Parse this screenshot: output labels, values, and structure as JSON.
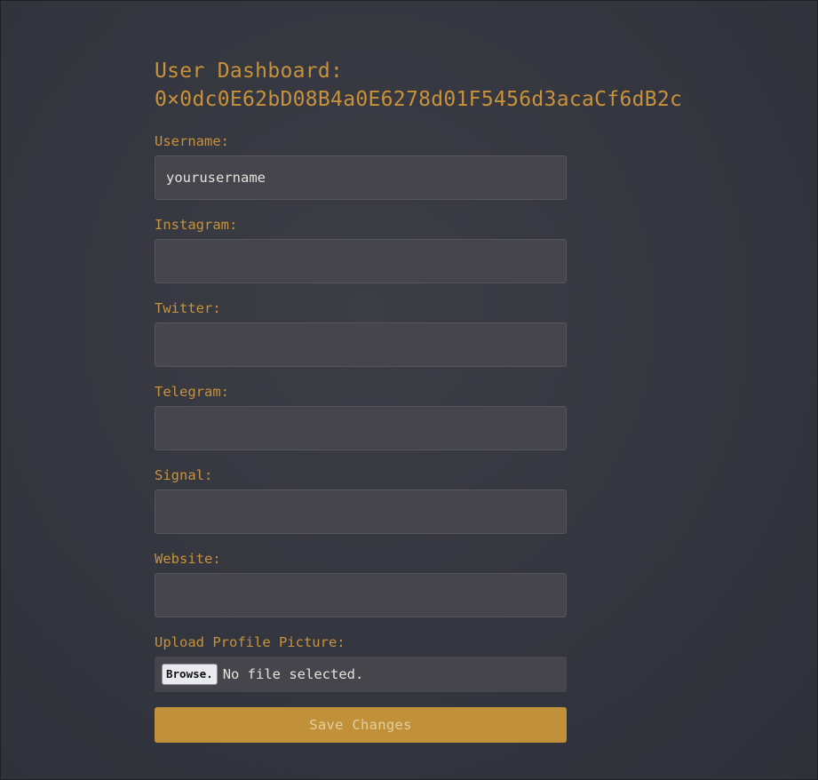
{
  "header": {
    "title_line1": "User Dashboard:",
    "title_line2": "0×0dc0E62bD08B4a0E6278d01F5456d3acaCf6dB2c"
  },
  "form": {
    "fields": [
      {
        "label": "Username:",
        "value": "yourusername",
        "placeholder": ""
      },
      {
        "label": "Instagram:",
        "value": "",
        "placeholder": ""
      },
      {
        "label": "Twitter:",
        "value": "",
        "placeholder": ""
      },
      {
        "label": "Telegram:",
        "value": "",
        "placeholder": ""
      },
      {
        "label": "Signal:",
        "value": "",
        "placeholder": ""
      },
      {
        "label": "Website:",
        "value": "",
        "placeholder": ""
      }
    ],
    "upload": {
      "label": "Upload Profile Picture:",
      "browse_label": "Browse.",
      "status": "No file selected."
    },
    "save_label": "Save Changes"
  },
  "colors": {
    "accent": "#c8923a",
    "background": "#353740",
    "input_background": "#46454b",
    "button_background": "#c1913a"
  }
}
